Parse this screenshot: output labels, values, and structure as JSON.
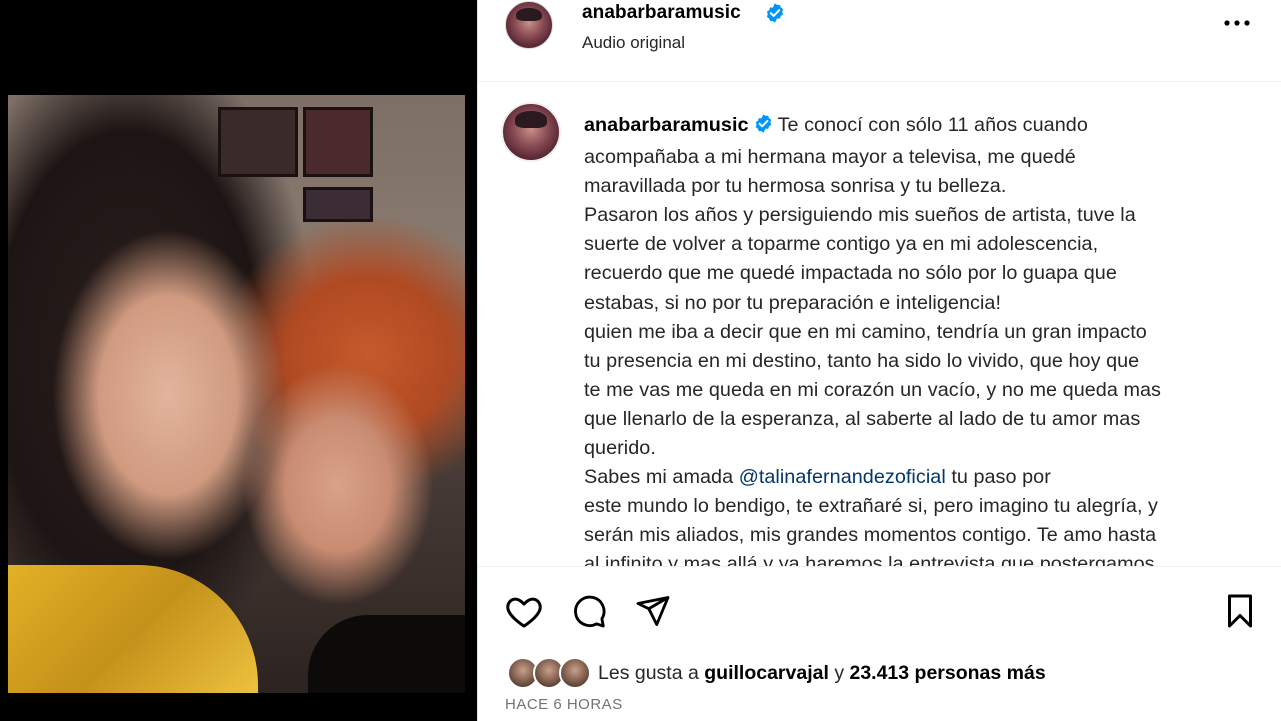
{
  "post": {
    "username": "anabarbaramusic",
    "audio_label": "Audio original",
    "more_label": "•••",
    "caption_lines": [
      "Te conocí con sólo 11 años cuando",
      "acompañaba a mi hermana mayor a televisa, me quedé",
      "maravillada por tu hermosa sonrisa y tu belleza.",
      "Pasaron los años y persiguiendo mis sueños de artista, tuve la",
      "suerte de volver a toparme contigo ya en mi adolescencia,",
      "recuerdo que me quedé impactada no sólo por lo guapa que",
      "estabas, si no por tu preparación e inteligencia!",
      "quien me iba a decir que en mi camino, tendría un gran impacto",
      "tu presencia en mi destino, tanto ha sido lo vivido, que hoy que",
      "te me vas me queda en mi corazón un vacío, y no me queda mas",
      "que llenarlo de la esperanza, al saberte al lado de tu amor mas",
      "querido.",
      "Sabes mi amada",
      "tu paso por",
      "este mundo lo bendigo, te extrañaré si, pero imagino tu alegría, y",
      "serán mis aliados, mis grandes momentos contigo. Te amo hasta",
      "al infinito y mas allá y ya haremos la entrevista que postergamos"
    ],
    "mention": "@talinafernandezoficial",
    "likes_prefix": "Les gusta a",
    "likes_user": "guillocarvajal",
    "likes_joiner": "y",
    "likes_count": "23.413 personas más",
    "timestamp": "HACE 6 HORAS"
  },
  "icons": {
    "like": "heart-icon",
    "comment": "comment-icon",
    "share": "send-icon",
    "save": "bookmark-icon",
    "verified": "verified-badge-icon",
    "more": "more-options-icon"
  },
  "colors": {
    "verified_blue": "#0095f6",
    "mention": "#00376b",
    "timestamp": "#737373"
  }
}
